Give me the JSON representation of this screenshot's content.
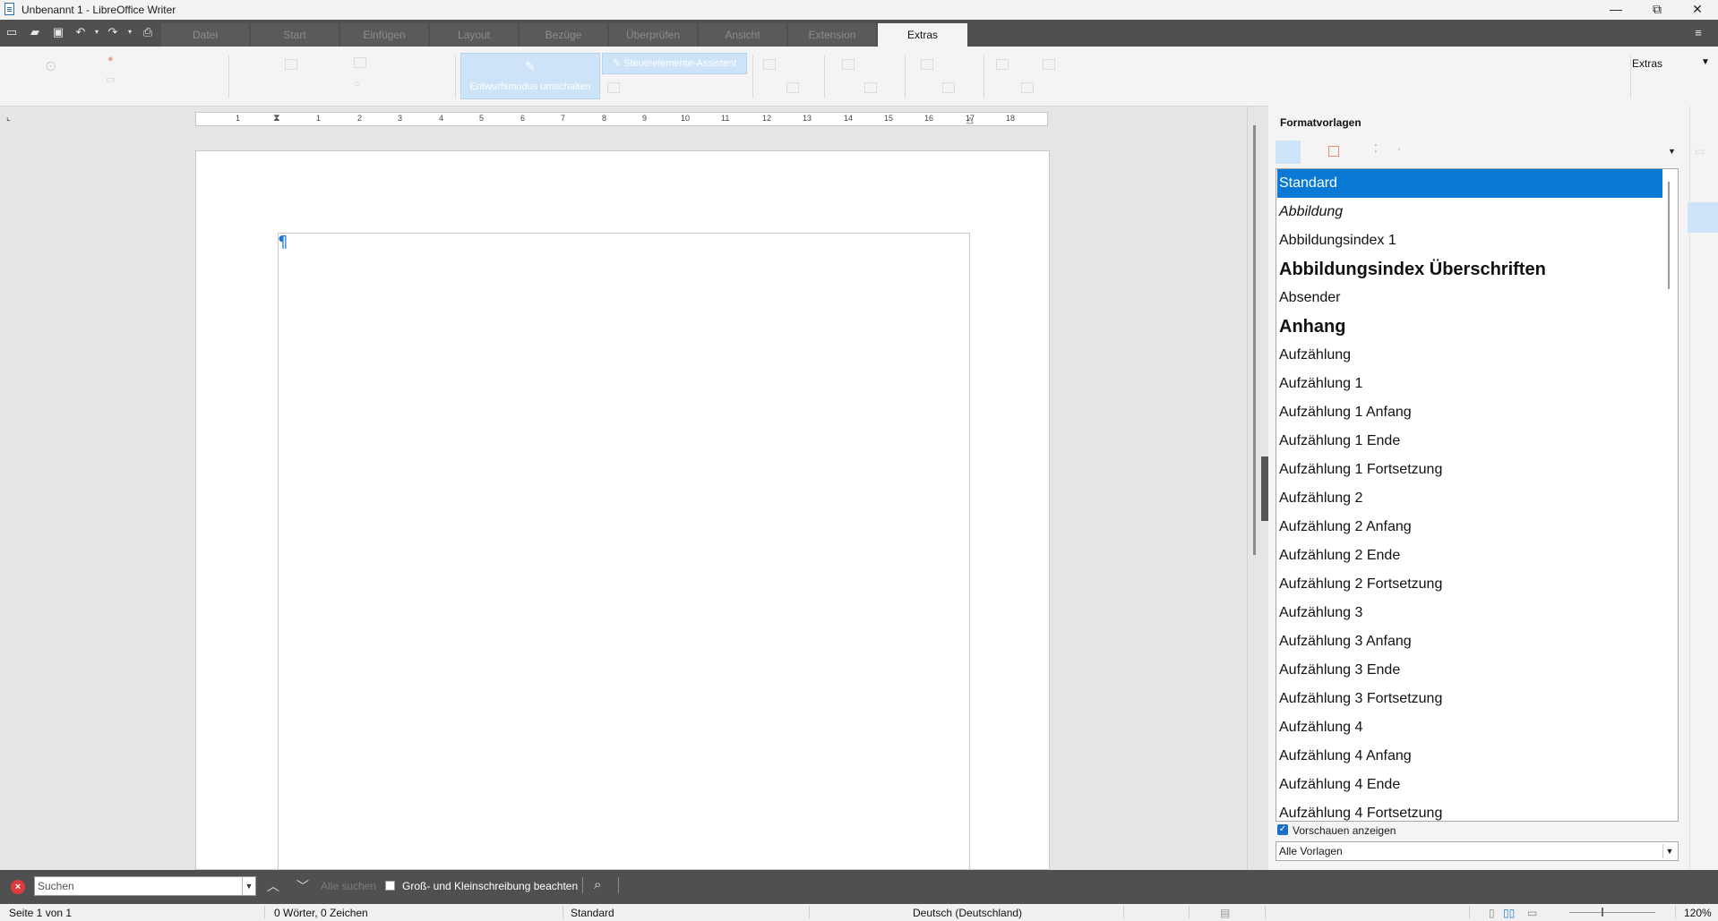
{
  "window": {
    "title": "Unbenannt 1 - LibreOffice Writer",
    "minimize": "—",
    "maximize": "⧉",
    "close": "✕"
  },
  "tabs": [
    {
      "label": "Datei"
    },
    {
      "label": "Start"
    },
    {
      "label": "Einfügen"
    },
    {
      "label": "Layout"
    },
    {
      "label": "Bezüge"
    },
    {
      "label": "Überprüfen"
    },
    {
      "label": "Ansicht"
    },
    {
      "label": "Extension"
    },
    {
      "label": "Extras"
    }
  ],
  "ribbon": {
    "design_mode": "Entwurfsmodus umschalten",
    "control_wizard": "Steuerelemente-Assistent",
    "extras_dropdown": "Extras"
  },
  "ruler": {
    "numbers": [
      "1",
      "1",
      "2",
      "3",
      "4",
      "5",
      "6",
      "7",
      "8",
      "9",
      "10",
      "11",
      "12",
      "13",
      "14",
      "15",
      "16",
      "17",
      "18"
    ]
  },
  "document": {
    "paragraph_mark": "¶"
  },
  "sidebar": {
    "title": "Formatvorlagen",
    "styles": [
      {
        "label": "Standard",
        "selected": true
      },
      {
        "label": "Abbildung",
        "italic": true
      },
      {
        "label": "Abbildungsindex 1"
      },
      {
        "label": "Abbildungsindex Überschriften",
        "bold": true
      },
      {
        "label": "Absender"
      },
      {
        "label": "Anhang",
        "bold": true
      },
      {
        "label": "Aufzählung"
      },
      {
        "label": "Aufzählung 1"
      },
      {
        "label": "Aufzählung 1 Anfang"
      },
      {
        "label": "Aufzählung 1 Ende"
      },
      {
        "label": "Aufzählung 1 Fortsetzung"
      },
      {
        "label": "Aufzählung 2"
      },
      {
        "label": "Aufzählung 2 Anfang"
      },
      {
        "label": "Aufzählung 2 Ende"
      },
      {
        "label": "Aufzählung 2 Fortsetzung"
      },
      {
        "label": "Aufzählung 3"
      },
      {
        "label": "Aufzählung 3 Anfang"
      },
      {
        "label": "Aufzählung 3 Ende"
      },
      {
        "label": "Aufzählung 3 Fortsetzung"
      },
      {
        "label": "Aufzählung 4"
      },
      {
        "label": "Aufzählung 4 Anfang"
      },
      {
        "label": "Aufzählung 4 Ende"
      },
      {
        "label": "Aufzählung 4 Fortsetzung"
      }
    ],
    "show_previews_label": "Vorschauen anzeigen",
    "show_previews_checked": true,
    "filter_value": "Alle Vorlagen"
  },
  "findbar": {
    "search_placeholder": "Suchen",
    "find_all": "Alle suchen",
    "match_case_label": "Groß- und Kleinschreibung beachten",
    "match_case_checked": false
  },
  "statusbar": {
    "page": "Seite 1 von 1",
    "words": "0 Wörter, 0 Zeichen",
    "page_style": "Standard",
    "language": "Deutsch (Deutschland)",
    "zoom": "120%"
  },
  "colors": {
    "accent": "#0a79d6",
    "tabbar": "#505050",
    "active_highlight": "#cde3f7"
  }
}
